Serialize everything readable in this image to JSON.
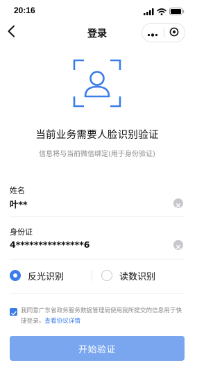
{
  "status_bar": {
    "time": "20:16",
    "icons": [
      "signal-icon",
      "wifi-icon",
      "battery-icon"
    ]
  },
  "nav": {
    "title": "登录",
    "back_icon": "chevron-left-icon",
    "more_icon": "more-icon",
    "close_icon": "target-icon"
  },
  "face": {
    "icon": "face-scan-icon",
    "title": "当前业务需要人脸识别验证",
    "subtitle": "信息将与当前微信绑定(用于身份验证)"
  },
  "form": {
    "name_label": "姓名",
    "name_value": "叶**",
    "id_label": "身份证",
    "id_value": "4***************6"
  },
  "mode": {
    "options": [
      {
        "label": "反光识别",
        "selected": true
      },
      {
        "label": "读数识别",
        "selected": false
      }
    ]
  },
  "agreement": {
    "checked": true,
    "text": "我同意广东省政务服务数据管理局使用我所提交的信息用于快捷登录。",
    "link": "查看协议详情"
  },
  "primary_button": {
    "label": "开始验证"
  },
  "colors": {
    "accent": "#3a7ce9",
    "button_bg": "#7aa6ef",
    "subtle_text": "#8a8a8a"
  }
}
